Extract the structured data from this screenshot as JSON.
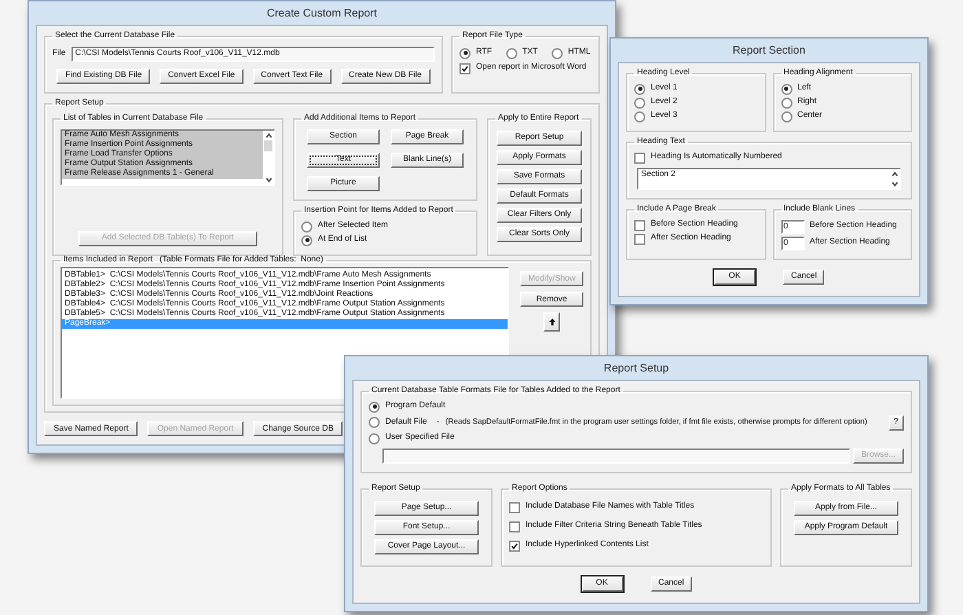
{
  "create_custom_report": {
    "title": "Create Custom Report",
    "database_file": {
      "label": "Select the Current Database File",
      "field_label": "File",
      "value": "C:\\CSI Models\\Tennis Courts Roof_v106_V11_V12.mdb",
      "buttons": [
        "Find Existing DB File",
        "Convert Excel File",
        "Convert Text File",
        "Create New DB File"
      ]
    },
    "report_file_type": {
      "label": "Report File Type",
      "options": [
        {
          "label": "RTF",
          "selected": true
        },
        {
          "label": "TXT",
          "selected": false
        },
        {
          "label": "HTML",
          "selected": false
        }
      ],
      "open_in_word": {
        "label": "Open report in Microsoft Word",
        "checked": true
      }
    },
    "report_setup": {
      "label": "Report Setup",
      "tables": {
        "label": "List of Tables in Current Database File",
        "items": [
          {
            "label": "Frame Auto Mesh Assignments",
            "selected": true
          },
          {
            "label": "Frame Insertion Point Assignments",
            "selected": true
          },
          {
            "label": "Frame Load Transfer Options",
            "selected": true
          },
          {
            "label": "Frame Output Station Assignments",
            "selected": true
          },
          {
            "label": "Frame Release Assignments 1 - General",
            "selected": true
          }
        ],
        "add_button": {
          "label": "Add Selected DB Table(s) To Report",
          "disabled": true
        }
      },
      "add_items": {
        "label": "Add Additional Items to Report",
        "buttons": [
          {
            "label": "Section",
            "focused": false
          },
          {
            "label": "Page Break",
            "focused": false
          },
          {
            "label": "Text",
            "focused": true
          },
          {
            "label": "Blank Line(s)",
            "focused": false
          },
          {
            "label": "Picture",
            "focused": false
          }
        ]
      },
      "insertion_point": {
        "label": "Insertion Point for Items Added to Report",
        "options": [
          {
            "label": "After Selected Item",
            "selected": false
          },
          {
            "label": "At End of List",
            "selected": true
          }
        ]
      },
      "apply_to_entire_report": {
        "label": "Apply to Entire Report",
        "buttons": [
          "Report Setup",
          "Apply Formats",
          "Save Formats",
          "Default Formats",
          "Clear Filters Only",
          "Clear Sorts Only"
        ]
      },
      "items_included": {
        "label": "Items Included in Report   (Table Formats File for Added Tables:  None)",
        "rows": [
          {
            "label": "DBTable1>  C:\\CSI Models\\Tennis Courts Roof_v106_V11_V12.mdb\\Frame Auto Mesh Assignments",
            "selected": false
          },
          {
            "label": "DBTable2>  C:\\CSI Models\\Tennis Courts Roof_v106_V11_V12.mdb\\Frame Insertion Point Assignments",
            "selected": false
          },
          {
            "label": "DBTable3>  C:\\CSI Models\\Tennis Courts Roof_v106_V11_V12.mdb\\Joint Reactions",
            "selected": false
          },
          {
            "label": "DBTable4>  C:\\CSI Models\\Tennis Courts Roof_v106_V11_V12.mdb\\Frame Output Station Assignments",
            "selected": false
          },
          {
            "label": "DBTable5>  C:\\CSI Models\\Tennis Courts Roof_v106_V11_V12.mdb\\Frame Output Station Assignments",
            "selected": false
          },
          {
            "label": "PageBreak>",
            "selected": true
          }
        ],
        "buttons": [
          {
            "label": "Modify/Show",
            "disabled": true
          },
          {
            "label": "Remove",
            "disabled": false
          }
        ]
      }
    },
    "bottom_buttons": [
      {
        "label": "Save Named Report",
        "disabled": false
      },
      {
        "label": "Open Named Report",
        "disabled": true
      },
      {
        "label": "Change Source DB",
        "disabled": false
      }
    ]
  },
  "report_section": {
    "title": "Report Section",
    "heading_level": {
      "label": "Heading Level",
      "options": [
        {
          "label": "Level 1",
          "selected": true
        },
        {
          "label": "Level 2",
          "selected": false
        },
        {
          "label": "Level 3",
          "selected": false
        }
      ]
    },
    "heading_alignment": {
      "label": "Heading Alignment",
      "options": [
        {
          "label": "Left",
          "selected": true
        },
        {
          "label": "Right",
          "selected": false
        },
        {
          "label": "Center",
          "selected": false
        }
      ]
    },
    "heading_text": {
      "label": "Heading Text",
      "auto_numbered": {
        "label": "Heading Is Automatically Numbered",
        "checked": false
      },
      "value": "Section 2"
    },
    "page_break": {
      "label": "Include A Page Break",
      "options": [
        {
          "label": "Before Section Heading",
          "checked": false
        },
        {
          "label": "After Section Heading",
          "checked": false
        }
      ]
    },
    "blank_lines": {
      "label": "Include Blank Lines",
      "rows": [
        {
          "value": "0",
          "label": "Before Section Heading"
        },
        {
          "value": "0",
          "label": "After Section Heading"
        }
      ]
    },
    "buttons": [
      {
        "label": "OK",
        "default": true
      },
      {
        "label": "Cancel",
        "default": false
      }
    ]
  },
  "report_setup": {
    "title": "Report Setup",
    "formats_file": {
      "label": "Current Database Table Formats File for Tables Added to the Report",
      "options": [
        {
          "label": "Program Default",
          "selected": true
        },
        {
          "label": "Default File",
          "selected": false
        },
        {
          "label": "User Specified File",
          "selected": false
        }
      ],
      "default_file_note": "-   (Reads SapDefaultFormatFile.fmt in the program user settings folder, if fmt file exists, otherwise prompts for different option)",
      "help_button": "?",
      "browse_button": {
        "label": "Browse...",
        "disabled": true
      }
    },
    "page_group": {
      "label": "Report Setup",
      "buttons": [
        "Page Setup...",
        "Font Setup...",
        "Cover Page Layout..."
      ]
    },
    "report_options": {
      "label": "Report Options",
      "options": [
        {
          "label": "Include Database File Names with Table Titles",
          "checked": false
        },
        {
          "label": "Include Filter Criteria String Beneath Table Titles",
          "checked": false
        },
        {
          "label": "Include Hyperlinked Contents List",
          "checked": true
        }
      ]
    },
    "apply_formats": {
      "label": "Apply Formats to All Tables",
      "buttons": [
        "Apply from File...",
        "Apply Program Default"
      ]
    },
    "buttons": [
      {
        "label": "OK",
        "default": true
      },
      {
        "label": "Cancel",
        "default": false
      }
    ]
  }
}
